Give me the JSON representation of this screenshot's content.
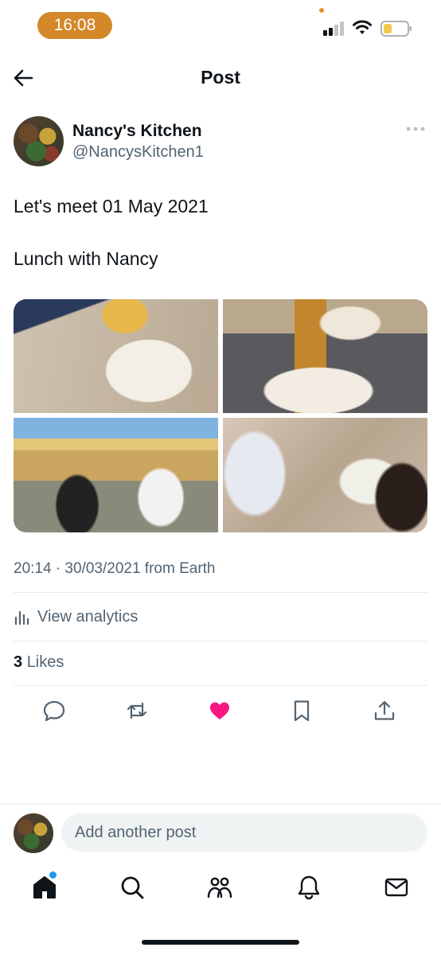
{
  "status_bar": {
    "time": "16:08"
  },
  "header": {
    "title": "Post"
  },
  "post": {
    "author_name": "Nancy's Kitchen",
    "author_handle": "@NancysKitchen1",
    "text_line1": "Let's meet 01 May 2021",
    "text_line2": "Lunch with Nancy",
    "timestamp": "20:14 · 30/03/2021 from Earth",
    "analytics_label": "View analytics",
    "likes_count": "3",
    "likes_label": "Likes",
    "liked": true,
    "media_count": 4
  },
  "composer": {
    "placeholder": "Add another post"
  },
  "colors": {
    "accent": "#1d9bf0",
    "like": "#f91880",
    "text_primary": "#0f1419",
    "text_secondary": "#536471",
    "time_pill": "#d4882a"
  },
  "icons": {
    "back": "arrow-left-icon",
    "more": "more-horizontal-icon",
    "reply": "reply-icon",
    "repost": "repost-icon",
    "like": "heart-icon",
    "bookmark": "bookmark-icon",
    "share": "share-icon",
    "analytics": "analytics-icon",
    "nav": [
      "home-icon",
      "search-icon",
      "communities-icon",
      "notifications-icon",
      "messages-icon"
    ]
  }
}
